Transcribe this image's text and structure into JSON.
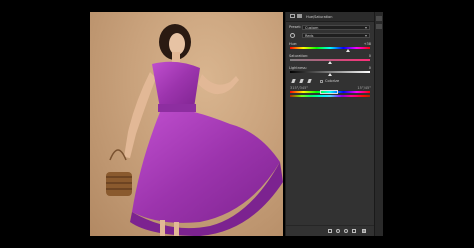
{
  "window": {
    "title": "Hue/Saturation"
  },
  "panel": {
    "header_icons": [
      "adjustment-layer-icon",
      "mask-icon"
    ],
    "preset_label": "Preset:",
    "preset_value": "Custom",
    "channel_value": "Reds",
    "hue": {
      "label": "Hue:",
      "value": "+38"
    },
    "saturation": {
      "label": "Saturation:",
      "value": "0"
    },
    "lightness": {
      "label": "Lightness:",
      "value": "0"
    },
    "colorize_label": "Colorize",
    "range_left": "315°/345°",
    "range_right": "15°/45°"
  },
  "colors": {
    "dress": "#a63cb4",
    "background_photo": "#c9a27c",
    "panel_bg": "#323232"
  }
}
